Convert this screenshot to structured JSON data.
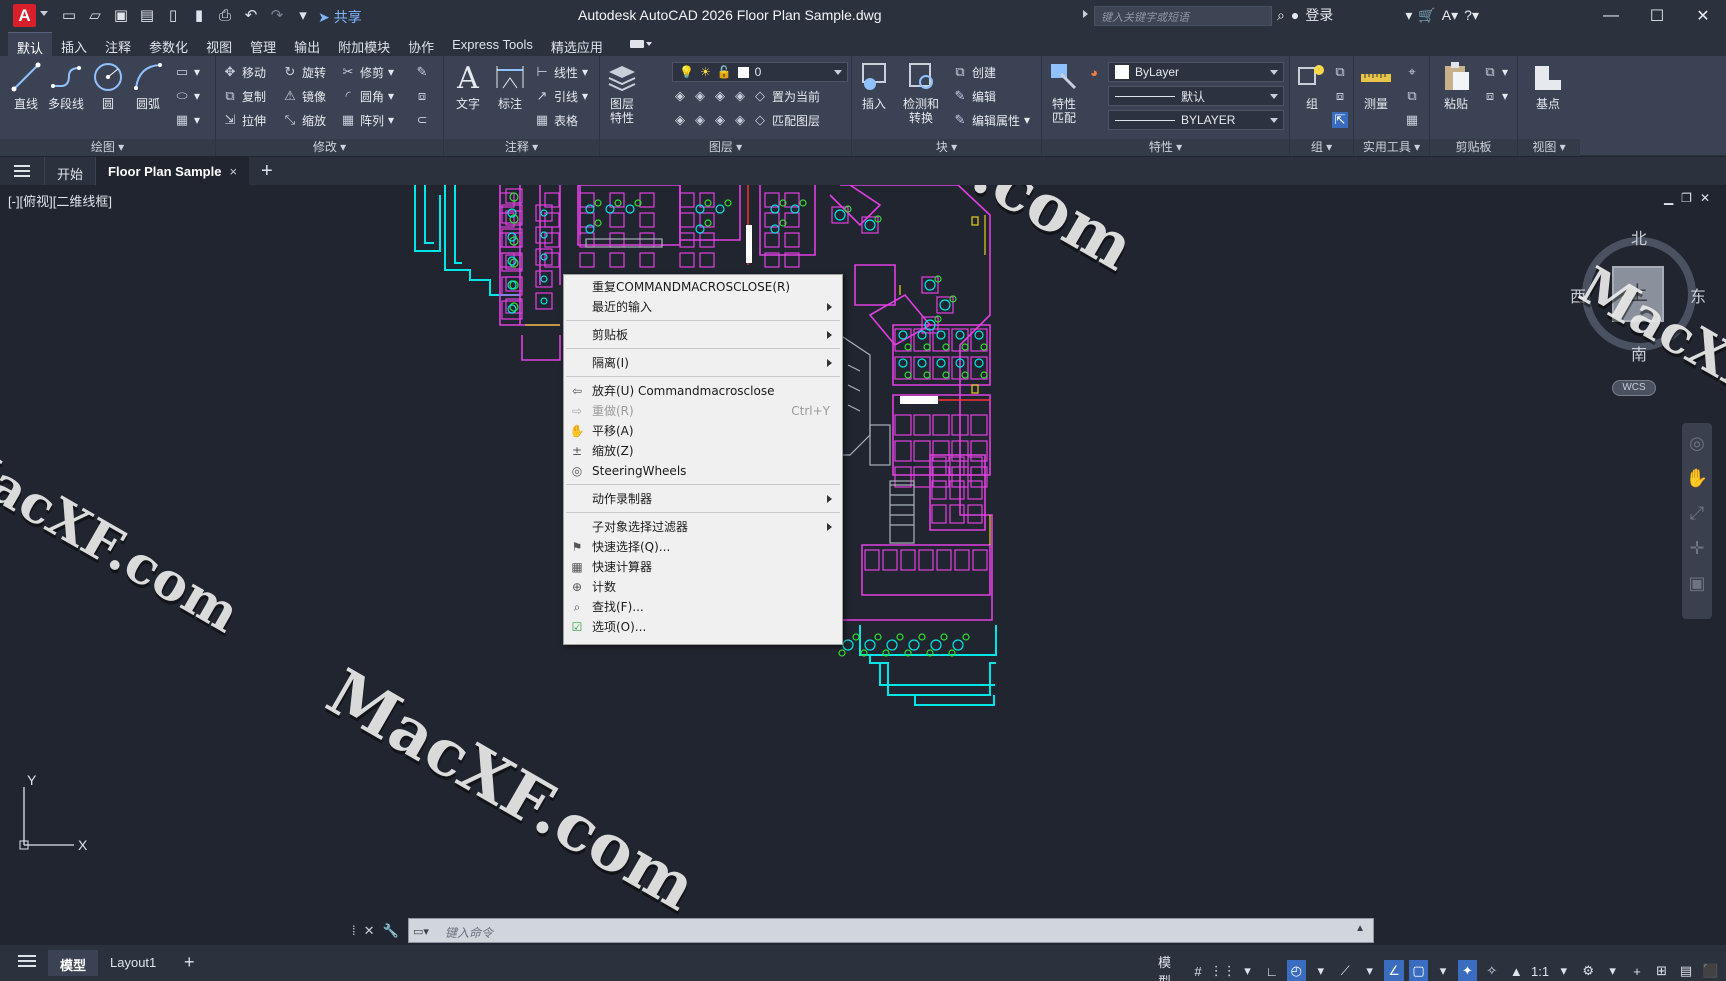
{
  "titlebar": {
    "logo_letter": "A",
    "share_label": "共享",
    "window_title": "Autodesk AutoCAD 2026    Floor Plan Sample.dwg",
    "search_placeholder": "键入关键字或短语",
    "login_label": "登录"
  },
  "ribbon_tabs": [
    "默认",
    "插入",
    "注释",
    "参数化",
    "视图",
    "管理",
    "输出",
    "附加模块",
    "协作",
    "Express Tools",
    "精选应用"
  ],
  "ribbon": {
    "draw": {
      "line": "直线",
      "polyline": "多段线",
      "circle": "圆",
      "arc": "圆弧",
      "title": "绘图"
    },
    "modify": {
      "move": "移动",
      "rotate": "旋转",
      "trim": "修剪",
      "copy": "复制",
      "mirror": "镜像",
      "fillet": "圆角",
      "stretch": "拉伸",
      "scale": "缩放",
      "array": "阵列",
      "title": "修改"
    },
    "annotation": {
      "text": "文字",
      "dimension": "标注",
      "linear": "线性",
      "leader": "引线",
      "table": "表格",
      "title": "注释"
    },
    "layers": {
      "layer_props_1": "图层",
      "layer_props_2": "特性",
      "current_layer": "0",
      "set_current": "置为当前",
      "match_layer": "匹配图层",
      "title": "图层"
    },
    "block": {
      "insert": "插入",
      "detect_1": "检测和",
      "detect_2": "转换",
      "create": "创建",
      "edit": "编辑",
      "edit_attr": "编辑属性",
      "title": "块"
    },
    "properties": {
      "match_1": "特性",
      "match_2": "匹配",
      "color": "ByLayer",
      "linetype": "默认",
      "lineweight": "BYLAYER",
      "title": "特性"
    },
    "groups": {
      "group": "组",
      "title": "组"
    },
    "utilities": {
      "measure": "测量",
      "title": "实用工具"
    },
    "clipboard": {
      "paste": "粘贴",
      "title": "剪贴板"
    },
    "view": {
      "base": "基点",
      "title": "视图"
    }
  },
  "doc_tabs": {
    "start": "开始",
    "active": "Floor Plan Sample",
    "close": "×",
    "add": "+"
  },
  "viewport": {
    "label": "[-][俯视][二维线框]",
    "viewcube": {
      "north": "北",
      "south": "南",
      "east": "东",
      "west": "西",
      "face": "上",
      "wcs": "WCS"
    },
    "ucs": {
      "x": "X",
      "y": "Y"
    }
  },
  "context_menu": {
    "repeat": "重复COMMANDMACROSCLOSE(R)",
    "recent_input": "最近的输入",
    "clipboard": "剪贴板",
    "isolate": "隔离(I)",
    "undo": "放弃(U) Commandmacrosclose",
    "redo": "重做(R)",
    "redo_shortcut": "Ctrl+Y",
    "pan": "平移(A)",
    "zoom": "缩放(Z)",
    "steering": "SteeringWheels",
    "action_recorder": "动作录制器",
    "subobject_filter": "子对象选择过滤器",
    "quick_select": "快速选择(Q)...",
    "quickcalc": "快速计算器",
    "count": "计数",
    "find": "查找(F)...",
    "options": "选项(O)..."
  },
  "command_line": {
    "placeholder": "键入命令"
  },
  "statusbar": {
    "model_tab": "模型",
    "layout_tab": "Layout1",
    "add": "+",
    "model_label": "模型",
    "scale": "1:1"
  },
  "watermarks": {
    "text": "MacXF.com"
  },
  "colors": {
    "accent": "#3a6cbf",
    "wall_cyan": "#00e5e5",
    "furniture_magenta": "#e040e0",
    "chair_green": "#33dd33",
    "door_yellow": "#e6d21e"
  }
}
